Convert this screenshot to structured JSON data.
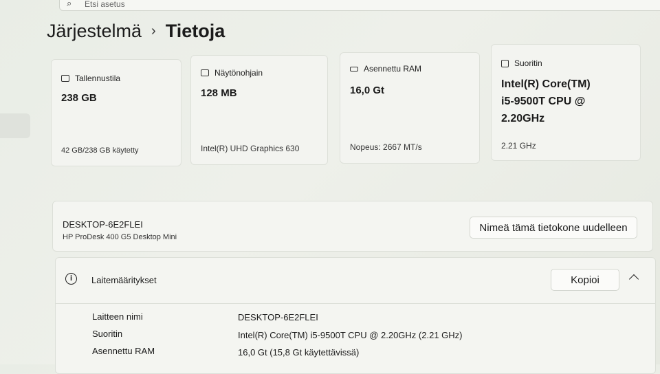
{
  "search": {
    "placeholder": "Etsi asetus"
  },
  "breadcrumb": {
    "parent": "Järjestelmä",
    "separator": "›",
    "current": "Tietoja"
  },
  "cards": [
    {
      "icon": "storage-icon",
      "label": "Tallennustila",
      "value": "238 GB",
      "sub": "42 GB/238 GB käytetty"
    },
    {
      "icon": "display-adapter-icon",
      "label": "Näytönohjain",
      "value": "128 MB",
      "sub": "Intel(R) UHD Graphics 630"
    },
    {
      "icon": "ram-icon",
      "label": "Asennettu RAM",
      "value": "16,0 Gt",
      "sub": "Nopeus: 2667 MT/s"
    },
    {
      "icon": "cpu-icon",
      "label": "Suoritin",
      "value_lines": [
        "Intel(R) Core(TM)",
        "i5-9500T CPU @",
        "2.20GHz"
      ],
      "sub": "2.21 GHz"
    }
  ],
  "device": {
    "name": "DESKTOP-6E2FLEI",
    "model": "HP ProDesk 400 G5 Desktop Mini",
    "rename_button": "Nimeä tämä tietokone uudelleen"
  },
  "specs": {
    "title": "Laitemääritykset",
    "copy_button": "Kopioi",
    "rows": [
      {
        "label": "Laitteen nimi",
        "value": "DESKTOP-6E2FLEI"
      },
      {
        "label": "Suoritin",
        "value": "Intel(R) Core(TM) i5-9500T CPU @ 2.20GHz (2.21 GHz)"
      },
      {
        "label": "Asennettu RAM",
        "value": "16,0 Gt (15,8 Gt käytettävissä)"
      }
    ]
  }
}
